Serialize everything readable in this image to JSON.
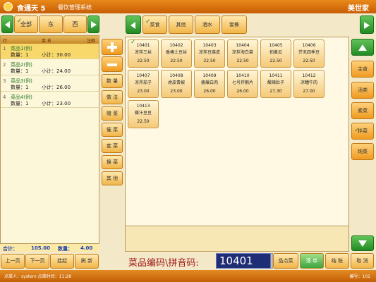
{
  "titlebar": {
    "app_name": "食通天 5",
    "subtitle": "餐饮管理系统",
    "brand": "美世家"
  },
  "left_categories": [
    "全部",
    "东",
    "西"
  ],
  "top_categories": [
    "菜食",
    "其他",
    "酒水",
    "套餐"
  ],
  "order_header": {
    "col1": "行",
    "col2": "菜 名",
    "col3": "注释"
  },
  "orders": [
    {
      "idx": "1",
      "name": "菜品1(例)",
      "qty": "数量：1",
      "sub": "小计：30.00"
    },
    {
      "idx": "2",
      "name": "菜品2(例)",
      "qty": "数量：1",
      "sub": "小计：24.00"
    },
    {
      "idx": "3",
      "name": "菜品3(例)",
      "qty": "数量：1",
      "sub": "小计：26.00"
    },
    {
      "idx": "4",
      "name": "菜品4(例)",
      "qty": "数量：1",
      "sub": "小计：23.00"
    }
  ],
  "totals": {
    "label": "合计：",
    "amount": "105.00",
    "qty_label": "数量：",
    "qty": "4.00"
  },
  "left_pager": [
    "上一页",
    "下一页",
    "挂起",
    "刷 新"
  ],
  "mid_buttons": [
    "数 量",
    "做 法",
    "赠 菜",
    "催 菜",
    "套 菜",
    "换 菜",
    "其 他"
  ],
  "dishes": [
    {
      "code": "10401",
      "name": "凉拌三丝",
      "price": "22.50"
    },
    {
      "code": "10402",
      "name": "香椿土豆丝",
      "price": "22.50"
    },
    {
      "code": "10403",
      "name": "凉拌豆腐皮",
      "price": "22.50"
    },
    {
      "code": "10404",
      "name": "凉拌海白菜",
      "price": "22.50"
    },
    {
      "code": "10405",
      "name": "拍黄瓜",
      "price": "22.50"
    },
    {
      "code": "10406",
      "name": "芥末四季豆",
      "price": "22.50"
    },
    {
      "code": "10407",
      "name": "凉拌茄子",
      "price": "23.00"
    },
    {
      "code": "10408",
      "name": "虎皮青椒",
      "price": "23.00"
    },
    {
      "code": "10409",
      "name": "酱爆白肉",
      "price": "26.00"
    },
    {
      "code": "10410",
      "name": "七号拌鹅片",
      "price": "26.00"
    },
    {
      "code": "10411",
      "name": "酸辣肚子",
      "price": "27.30"
    },
    {
      "code": "10412",
      "name": "凉糟牛肉",
      "price": "27.00"
    },
    {
      "code": "10413",
      "name": "藤汁豆豆",
      "price": "22.50"
    }
  ],
  "right_categories": [
    "主食",
    "汤类",
    "素菜",
    "拌菜",
    "炖菜"
  ],
  "code_label": "菜品编码\\拼音码:",
  "code_value": "10401",
  "action_buttons": [
    "品点菜",
    "落 单",
    "结 账",
    "取 消"
  ],
  "status": {
    "left": "点菜人：system   点菜时间：11:28",
    "right": "编号：101"
  }
}
